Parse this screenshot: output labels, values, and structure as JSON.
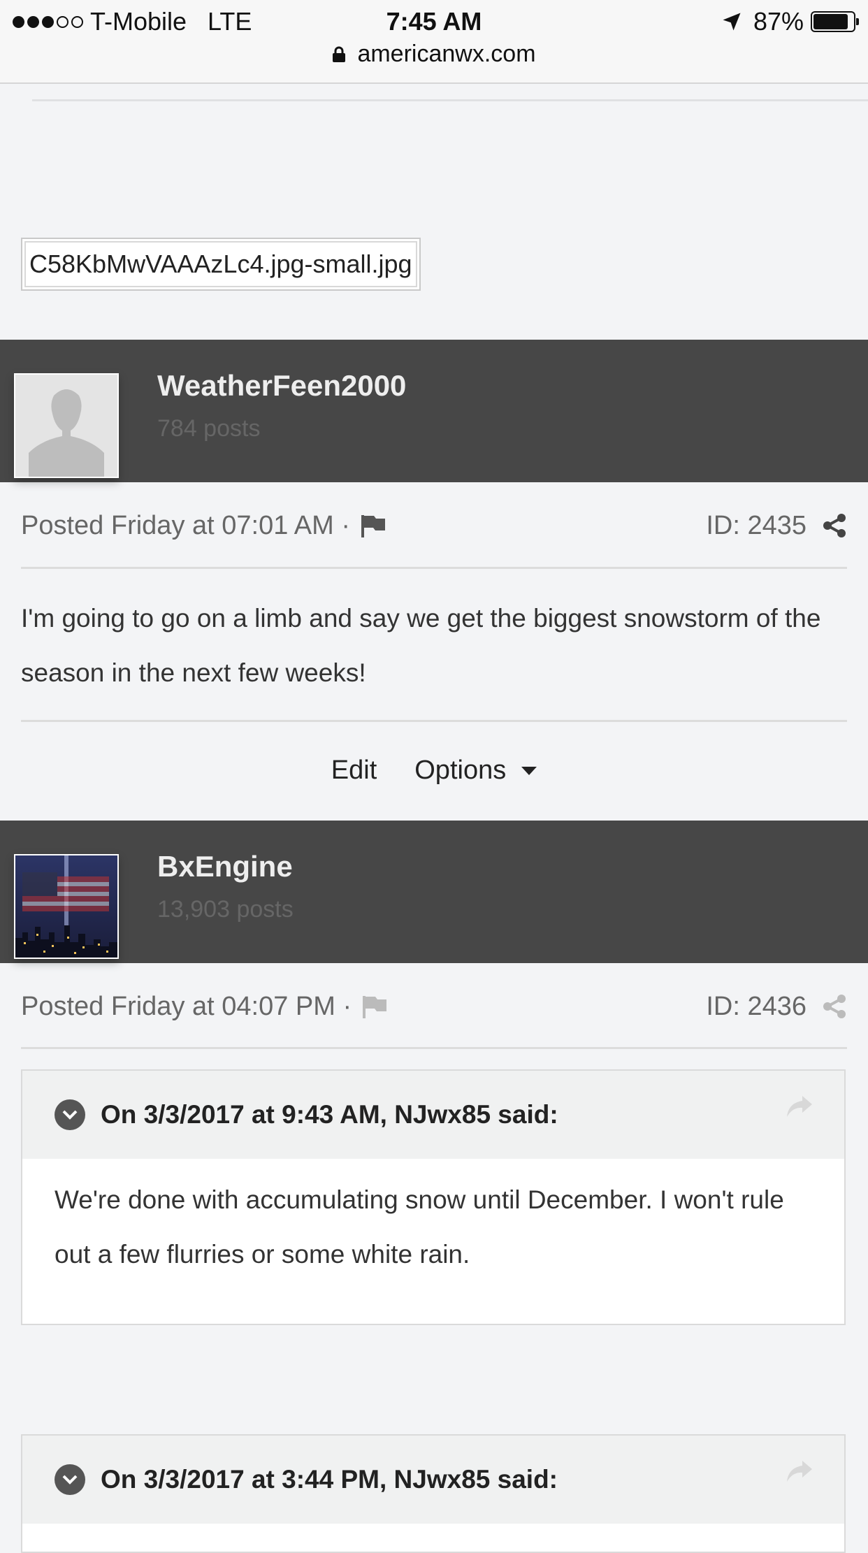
{
  "status_bar": {
    "carrier": "T-Mobile",
    "network": "LTE",
    "time": "7:45 AM",
    "battery": "87%",
    "battery_level": 0.87,
    "signal_bars": 3
  },
  "browser": {
    "url": "americanwx.com"
  },
  "attachment": {
    "filename": "C58KbMwVAAAzLc4.jpg-small.jpg"
  },
  "posts": [
    {
      "author": "WeatherFeen2000",
      "post_count": "784 posts",
      "posted": "Posted Friday at 07:01 AM ·",
      "id": "ID: 2435",
      "body": "I'm going to go on a limb and say we get the biggest snowstorm of the season in the next few weeks!",
      "actions": {
        "edit": "Edit",
        "options": "Options"
      }
    },
    {
      "author": "BxEngine",
      "post_count": "13,903 posts",
      "posted": "Posted Friday at 04:07 PM ·",
      "id": "ID: 2436",
      "quotes": [
        {
          "header": "On 3/3/2017 at 9:43 AM, NJwx85 said:",
          "body": "We're done with accumulating snow until December. I won't rule out a few flurries or some white rain."
        },
        {
          "header": "On 3/3/2017 at 3:44 PM, NJwx85 said:",
          "body": ""
        }
      ]
    }
  ],
  "icons": [
    "location-arrow-icon",
    "lock-icon",
    "flag-icon",
    "share-icon",
    "chevron-down-icon",
    "reply-icon",
    "default-avatar-icon"
  ],
  "colors": {
    "author_bar": "#474747",
    "page_bg": "#f3f4f6",
    "quote_header": "#f0f1f1"
  }
}
